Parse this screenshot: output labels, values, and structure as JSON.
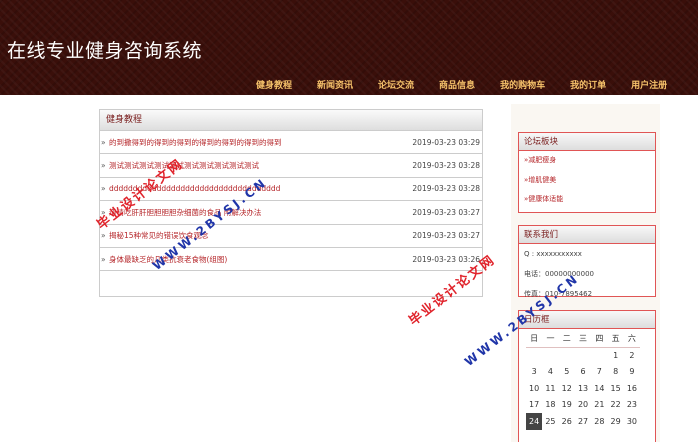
{
  "header": {
    "site_title": "在线专业健身咨询系统",
    "nav": [
      "健身教程",
      "新闻资讯",
      "论坛交流",
      "商品信息",
      "我的购物车",
      "我的订单",
      "用户注册"
    ]
  },
  "main": {
    "panel_title": "健身教程",
    "bullet": "»",
    "rows": [
      {
        "title": "的到撒得到的得到的得到的得到的得到的得到的得到",
        "date": "2019-03-23 03:29"
      },
      {
        "title": "测试测试测试测试测试测试测试测试测试测试",
        "date": "2019-03-23 03:28"
      },
      {
        "title": "dddddddddddddddddddddddddddddddddddd",
        "date": "2019-03-23 03:28"
      },
      {
        "title": "道请吃肝肝胆胆胆胆杂细菌的食品 附解决办法",
        "date": "2019-03-23 03:27"
      },
      {
        "title": "揭秘15种常见的错误饮食观念",
        "date": "2019-03-23 03:27"
      },
      {
        "title": "身体最缺乏的几类抗衰老食物(组图)",
        "date": "2019-03-23 03:26"
      }
    ]
  },
  "sidebar": {
    "forum": {
      "title": "论坛板块",
      "items": [
        "»减肥瘦身",
        "»增肌健美",
        "»健康体适能"
      ]
    },
    "contact": {
      "title": "联系我们",
      "lines": [
        "Q : xxxxxxxxxxx",
        "电话：00000000000",
        "传真：010-7895462"
      ]
    },
    "calendar": {
      "title": "日历框",
      "weekdays": [
        "日",
        "一",
        "二",
        "三",
        "四",
        "五",
        "六"
      ],
      "weeks": [
        [
          "",
          "",
          "",
          "",
          "",
          "1",
          "2"
        ],
        [
          "3",
          "4",
          "5",
          "6",
          "7",
          "8",
          "9"
        ],
        [
          "10",
          "11",
          "12",
          "13",
          "14",
          "15",
          "16"
        ],
        [
          "17",
          "18",
          "19",
          "20",
          "21",
          "22",
          "23"
        ],
        [
          "24",
          "25",
          "26",
          "27",
          "28",
          "29",
          "30"
        ]
      ],
      "today": "24"
    }
  },
  "watermarks": {
    "red": "毕业设计论文网",
    "blue": "WWW.2BYSJ.CN"
  }
}
